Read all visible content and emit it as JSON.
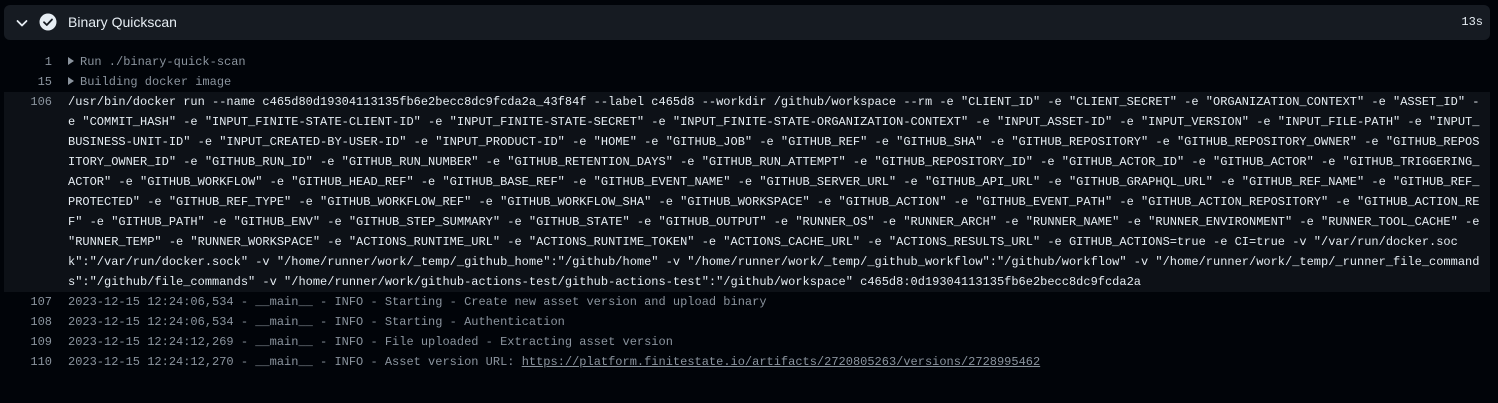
{
  "step": {
    "title": "Binary Quickscan",
    "duration": "13s",
    "icons": {
      "toggle": "chevron-down-icon",
      "status": "check-circle-icon"
    },
    "status_color": "#8b949e"
  },
  "log": {
    "groups": [
      {
        "line": "1",
        "text": "Run ./binary-quick-scan"
      },
      {
        "line": "15",
        "text": "Building docker image"
      }
    ],
    "command": {
      "line": "106",
      "text": "/usr/bin/docker run --name c465d80d19304113135fb6e2becc8dc9fcda2a_43f84f --label c465d8 --workdir /github/workspace --rm -e \"CLIENT_ID\" -e \"CLIENT_SECRET\" -e \"ORGANIZATION_CONTEXT\" -e \"ASSET_ID\" -e \"COMMIT_HASH\" -e \"INPUT_FINITE-STATE-CLIENT-ID\" -e \"INPUT_FINITE-STATE-SECRET\" -e \"INPUT_FINITE-STATE-ORGANIZATION-CONTEXT\" -e \"INPUT_ASSET-ID\" -e \"INPUT_VERSION\" -e \"INPUT_FILE-PATH\" -e \"INPUT_BUSINESS-UNIT-ID\" -e \"INPUT_CREATED-BY-USER-ID\" -e \"INPUT_PRODUCT-ID\" -e \"HOME\" -e \"GITHUB_JOB\" -e \"GITHUB_REF\" -e \"GITHUB_SHA\" -e \"GITHUB_REPOSITORY\" -e \"GITHUB_REPOSITORY_OWNER\" -e \"GITHUB_REPOSITORY_OWNER_ID\" -e \"GITHUB_RUN_ID\" -e \"GITHUB_RUN_NUMBER\" -e \"GITHUB_RETENTION_DAYS\" -e \"GITHUB_RUN_ATTEMPT\" -e \"GITHUB_REPOSITORY_ID\" -e \"GITHUB_ACTOR_ID\" -e \"GITHUB_ACTOR\" -e \"GITHUB_TRIGGERING_ACTOR\" -e \"GITHUB_WORKFLOW\" -e \"GITHUB_HEAD_REF\" -e \"GITHUB_BASE_REF\" -e \"GITHUB_EVENT_NAME\" -e \"GITHUB_SERVER_URL\" -e \"GITHUB_API_URL\" -e \"GITHUB_GRAPHQL_URL\" -e \"GITHUB_REF_NAME\" -e \"GITHUB_REF_PROTECTED\" -e \"GITHUB_REF_TYPE\" -e \"GITHUB_WORKFLOW_REF\" -e \"GITHUB_WORKFLOW_SHA\" -e \"GITHUB_WORKSPACE\" -e \"GITHUB_ACTION\" -e \"GITHUB_EVENT_PATH\" -e \"GITHUB_ACTION_REPOSITORY\" -e \"GITHUB_ACTION_REF\" -e \"GITHUB_PATH\" -e \"GITHUB_ENV\" -e \"GITHUB_STEP_SUMMARY\" -e \"GITHUB_STATE\" -e \"GITHUB_OUTPUT\" -e \"RUNNER_OS\" -e \"RUNNER_ARCH\" -e \"RUNNER_NAME\" -e \"RUNNER_ENVIRONMENT\" -e \"RUNNER_TOOL_CACHE\" -e \"RUNNER_TEMP\" -e \"RUNNER_WORKSPACE\" -e \"ACTIONS_RUNTIME_URL\" -e \"ACTIONS_RUNTIME_TOKEN\" -e \"ACTIONS_CACHE_URL\" -e \"ACTIONS_RESULTS_URL\" -e GITHUB_ACTIONS=true -e CI=true -v \"/var/run/docker.sock\":\"/var/run/docker.sock\" -v \"/home/runner/work/_temp/_github_home\":\"/github/home\" -v \"/home/runner/work/_temp/_github_workflow\":\"/github/workflow\" -v \"/home/runner/work/_temp/_runner_file_commands\":\"/github/file_commands\" -v \"/home/runner/work/github-actions-test/github-actions-test\":\"/github/workspace\" c465d8:0d19304113135fb6e2becc8dc9fcda2a"
    },
    "lines": [
      {
        "line": "107",
        "text": "2023-12-15 12:24:06,534 - __main__ - INFO - Starting - Create new asset version and upload binary"
      },
      {
        "line": "108",
        "text": "2023-12-15 12:24:06,534 - __main__ - INFO - Starting - Authentication"
      },
      {
        "line": "109",
        "text": "2023-12-15 12:24:12,269 - __main__ - INFO - File uploaded - Extracting asset version"
      }
    ],
    "last_line": {
      "line": "110",
      "prefix": "2023-12-15 12:24:12,270 - __main__ - INFO - Asset version URL: ",
      "url": "https://platform.finitestate.io/artifacts/2720805263/versions/2728995462"
    }
  }
}
